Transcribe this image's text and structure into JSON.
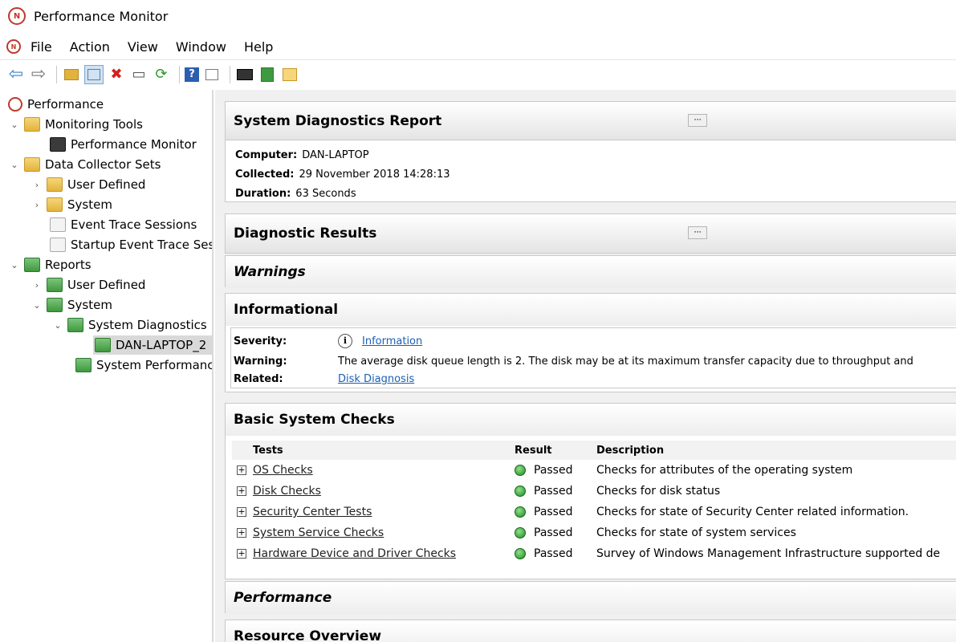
{
  "window": {
    "title": "Performance Monitor"
  },
  "menu": [
    "File",
    "Action",
    "View",
    "Window",
    "Help"
  ],
  "tree": [
    {
      "label": "Performance",
      "level": 0,
      "chevron": "",
      "icon": "perf"
    },
    {
      "label": "Monitoring Tools",
      "level": 1,
      "chevron": "open",
      "icon": "folder"
    },
    {
      "label": "Performance Monitor",
      "level": 2,
      "chevron": "",
      "icon": "monitor"
    },
    {
      "label": "Data Collector Sets",
      "level": 1,
      "chevron": "open",
      "icon": "folder"
    },
    {
      "label": "User Defined",
      "level": 2,
      "chevron": "closed",
      "icon": "folder"
    },
    {
      "label": "System",
      "level": 2,
      "chevron": "closed",
      "icon": "folder"
    },
    {
      "label": "Event Trace Sessions",
      "level": 2,
      "chevron": "",
      "icon": "doc"
    },
    {
      "label": "Startup Event Trace Ses",
      "level": 2,
      "chevron": "",
      "icon": "doc"
    },
    {
      "label": "Reports",
      "level": 1,
      "chevron": "open",
      "icon": "report"
    },
    {
      "label": "User Defined",
      "level": 2,
      "chevron": "closed",
      "icon": "report"
    },
    {
      "label": "System",
      "level": 2,
      "chevron": "open",
      "icon": "report"
    },
    {
      "label": "System Diagnostics",
      "level": 3,
      "chevron": "open",
      "icon": "report"
    },
    {
      "label": "DAN-LAPTOP_2",
      "level": 4,
      "chevron": "",
      "icon": "report",
      "selected": true
    },
    {
      "label": "System Performanc",
      "level": 3,
      "chevron": "",
      "icon": "report"
    }
  ],
  "report": {
    "title": "System Diagnostics Report",
    "computer_label": "Computer:",
    "computer": "DAN-LAPTOP",
    "collected_label": "Collected:",
    "collected": "29 November 2018 14:28:13",
    "duration_label": "Duration:",
    "duration": "63 Seconds"
  },
  "diagnostic_results": {
    "title": "Diagnostic Results"
  },
  "warnings": {
    "title": "Warnings"
  },
  "informational": {
    "title": "Informational",
    "severity_label": "Severity:",
    "severity": "Information",
    "warning_label": "Warning:",
    "warning": "The average disk queue length is 2. The disk may be at its maximum transfer capacity due to throughput and",
    "related_label": "Related:",
    "related": "Disk Diagnosis"
  },
  "basic_checks": {
    "title": "Basic System Checks",
    "headers": {
      "tests": "Tests",
      "result": "Result",
      "description": "Description"
    },
    "rows": [
      {
        "test": "OS Checks",
        "result": "Passed",
        "description": "Checks for attributes of the operating system"
      },
      {
        "test": "Disk Checks",
        "result": "Passed",
        "description": "Checks for disk status"
      },
      {
        "test": "Security Center Tests",
        "result": "Passed",
        "description": "Checks for state of Security Center related information."
      },
      {
        "test": "System Service Checks",
        "result": "Passed",
        "description": "Checks for state of system services"
      },
      {
        "test": "Hardware Device and Driver Checks",
        "result": "Passed",
        "description": "Survey of Windows Management Infrastructure supported de"
      }
    ]
  },
  "performance": {
    "title": "Performance"
  },
  "resource_overview": {
    "title": "Resource Overview"
  }
}
